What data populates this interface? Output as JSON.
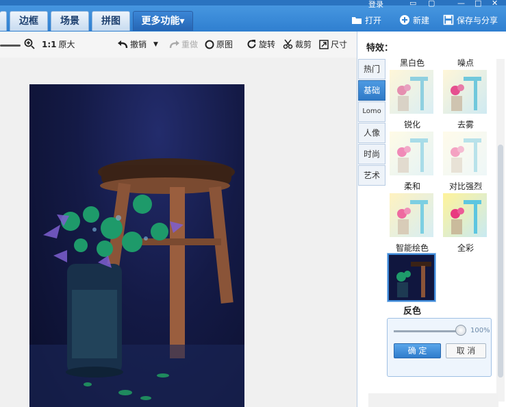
{
  "window": {
    "login_label": "登录"
  },
  "tabs": [
    {
      "label": "边框"
    },
    {
      "label": "场景"
    },
    {
      "label": "拼图"
    },
    {
      "label": "更多功能▾"
    }
  ],
  "top_actions": {
    "open": "打开",
    "new": "新建",
    "save_share": "保存与分享"
  },
  "toolbar": {
    "zoom_ratio": "1:1",
    "original_size": "原大",
    "undo": "撤销",
    "redo": "重做",
    "original_image": "原图",
    "rotate": "旋转",
    "crop": "裁剪",
    "size": "尺寸"
  },
  "panel": {
    "title": "特效：",
    "categories": [
      {
        "label": "热门"
      },
      {
        "label": "基础",
        "active": true
      },
      {
        "label": "Lomo"
      },
      {
        "label": "人像"
      },
      {
        "label": "时尚"
      },
      {
        "label": "艺术"
      }
    ],
    "effects": [
      {
        "label": "黑白色"
      },
      {
        "label": "噪点"
      },
      {
        "label": "锐化"
      },
      {
        "label": "去雾"
      },
      {
        "label": "柔和"
      },
      {
        "label": "对比强烈"
      },
      {
        "label": "智能绘色"
      },
      {
        "label": "全彩"
      },
      {
        "label": "反色",
        "selected": true
      }
    ],
    "adjust": {
      "level": 1.0,
      "percent_label": "100%",
      "ok": "确 定",
      "cancel": "取 消"
    }
  },
  "colors": {
    "accent": "#2f7fd0",
    "selected_border": "#3d89d9"
  }
}
